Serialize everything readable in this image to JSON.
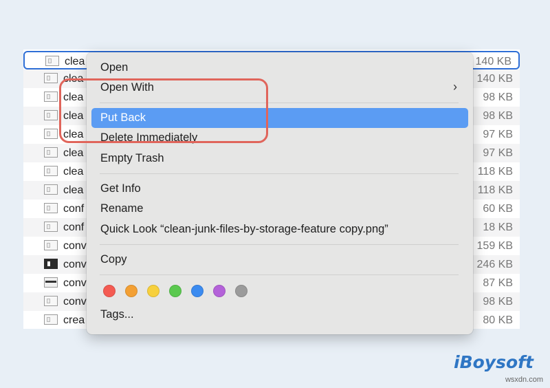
{
  "file_list": {
    "rows": [
      {
        "name": "clea",
        "size": "140 KB",
        "icon": "image-file-icon"
      },
      {
        "name": "clea",
        "size": "140 KB",
        "icon": "image-file-icon"
      },
      {
        "name": "clea",
        "size": "98 KB",
        "icon": "image-file-icon"
      },
      {
        "name": "clea",
        "size": "98 KB",
        "icon": "image-file-icon"
      },
      {
        "name": "clea",
        "size": "97 KB",
        "icon": "image-file-icon"
      },
      {
        "name": "clea",
        "size": "97 KB",
        "icon": "image-file-icon"
      },
      {
        "name": "clea",
        "size": "118 KB",
        "icon": "image-file-icon"
      },
      {
        "name": "clea",
        "size": "118 KB",
        "icon": "image-file-icon"
      },
      {
        "name": "conf",
        "size": "60 KB",
        "icon": "image-file-icon"
      },
      {
        "name": "conf",
        "size": "18 KB",
        "icon": "image-file-icon"
      },
      {
        "name": "conv",
        "size": "159 KB",
        "icon": "image-file-icon"
      },
      {
        "name": "conv",
        "size": "246 KB",
        "icon": "dark-image-file-icon"
      },
      {
        "name": "conv",
        "size": "87 KB",
        "icon": "image-file-icon"
      },
      {
        "name": "conv",
        "size": "98 KB",
        "icon": "image-file-icon"
      },
      {
        "name": "crea",
        "size": "80 KB",
        "icon": "image-file-icon"
      }
    ]
  },
  "context_menu": {
    "open": "Open",
    "open_with": "Open With",
    "submenu_arrow": "›",
    "put_back": "Put Back",
    "delete_immediately": "Delete Immediately",
    "empty_trash": "Empty Trash",
    "get_info": "Get Info",
    "rename": "Rename",
    "quick_look": "Quick Look “clean-junk-files-by-storage-feature copy.png”",
    "copy": "Copy",
    "tags": "Tags...",
    "tag_colors": [
      "#f45b52",
      "#f3a034",
      "#f7d03d",
      "#5bc94f",
      "#3b8bf0",
      "#b462d9",
      "#9b9b9b"
    ]
  },
  "highlight_color": "#5b9cf3",
  "callout_color": "#e0655b",
  "brand": {
    "name": "iBoysoft",
    "color": "#2f76c4"
  },
  "watermark": "wsxdn.com"
}
